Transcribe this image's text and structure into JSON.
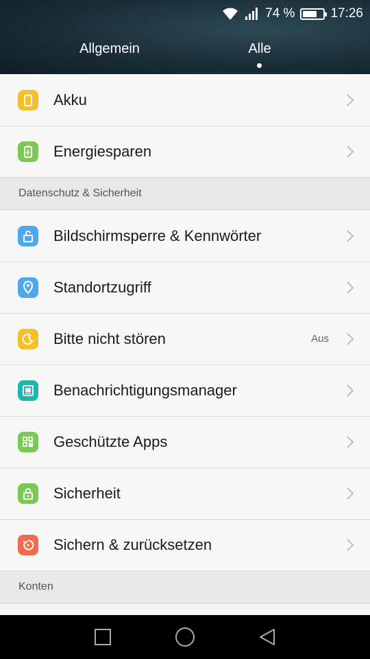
{
  "status_bar": {
    "battery_percent": "74 %",
    "battery_level": 0.74,
    "time": "17:26"
  },
  "tabs": [
    {
      "label": "Allgemein"
    },
    {
      "label": "Alle"
    }
  ],
  "colors": {
    "yellow": "#f8bf2a",
    "green": "#7bc855",
    "blue": "#4da9ea",
    "teal": "#1fb6ad",
    "orange": "#f26a4f"
  },
  "items_top": [
    {
      "label": "Akku",
      "icon": "battery-icon"
    },
    {
      "label": "Energiesparen",
      "icon": "power-saving-icon"
    }
  ],
  "section_privacy": {
    "title": "Datenschutz & Sicherheit"
  },
  "items_privacy": [
    {
      "label": "Bildschirmsperre & Kennwörter",
      "icon": "unlock-icon"
    },
    {
      "label": "Standortzugriff",
      "icon": "location-pin-icon"
    },
    {
      "label": "Bitte nicht stören",
      "icon": "moon-icon",
      "value": "Aus"
    },
    {
      "label": "Benachrichtigungsmanager",
      "icon": "notification-icon"
    },
    {
      "label": "Geschützte Apps",
      "icon": "protected-apps-icon"
    },
    {
      "label": "Sicherheit",
      "icon": "lock-icon"
    },
    {
      "label": "Sichern & zurücksetzen",
      "icon": "backup-reset-icon"
    }
  ],
  "section_accounts": {
    "title": "Konten"
  },
  "nav": {
    "recents": "square-icon",
    "home": "circle-icon",
    "back": "triangle-back-icon"
  }
}
